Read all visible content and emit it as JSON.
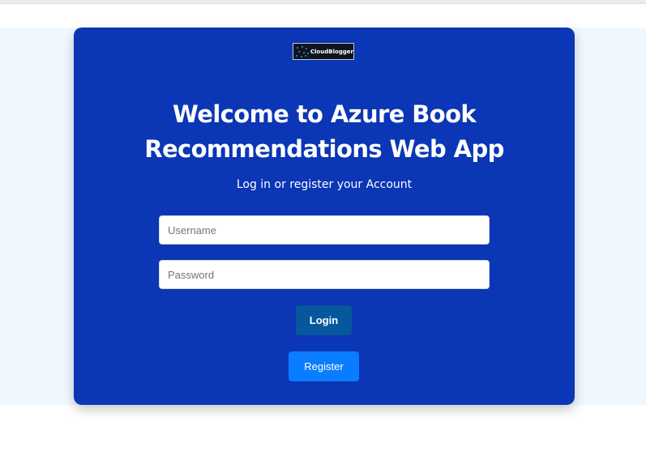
{
  "logo": {
    "text": "CloudBlogger",
    "icon": "cloud-blogger-logo-icon"
  },
  "heading": {
    "title": "Welcome to Azure Book Recommendations Web App"
  },
  "subtitle": "Log in or register your Account",
  "form": {
    "username_placeholder": "Username",
    "password_placeholder": "Password",
    "login_label": "Login",
    "register_label": "Register"
  },
  "colors": {
    "card_background": "#0b36b5",
    "page_band": "#f0f7ff",
    "login_button": "#07579c",
    "register_button": "#0a7cff"
  }
}
